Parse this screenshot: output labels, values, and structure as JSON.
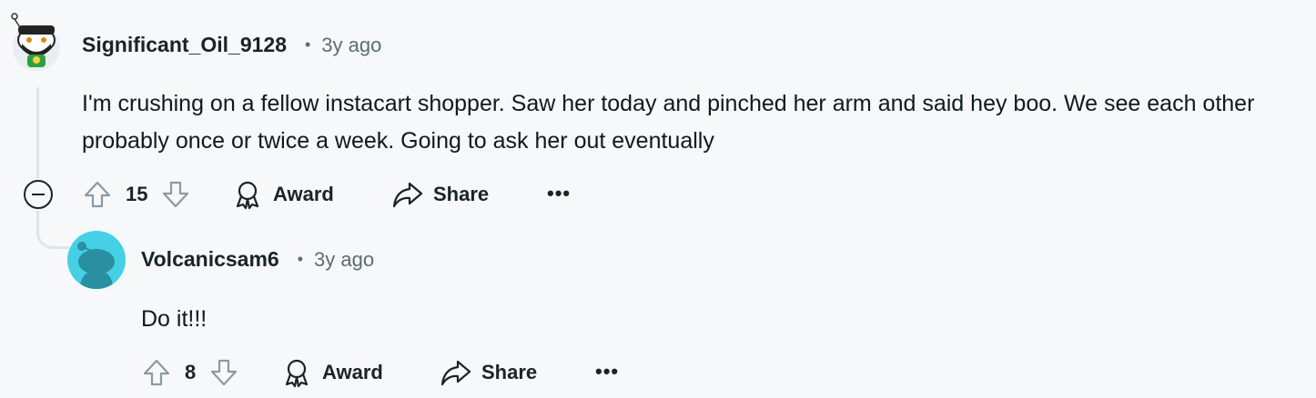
{
  "comments": [
    {
      "username": "Significant_Oil_9128",
      "separator": "•",
      "time": "3y ago",
      "body": "I'm crushing on a fellow instacart shopper. Saw her today and pinched her arm and said hey boo. We see each other probably once or twice a week. Going to ask her out eventually",
      "votes": "15",
      "award_label": "Award",
      "share_label": "Share",
      "more_label": "•••"
    },
    {
      "username": "Volcanicsam6",
      "separator": "•",
      "time": "3y ago",
      "body": "Do it!!!",
      "votes": "8",
      "award_label": "Award",
      "share_label": "Share",
      "more_label": "•••"
    }
  ],
  "colors": {
    "background": "#f6f8f9",
    "thread_line": "#dfe5e8",
    "avatar2_bg": "#45d0e6",
    "text": "#0f1a1c",
    "meta": "#5c6c74"
  },
  "icons": {
    "upvote": "arrow-up-outline",
    "downvote": "arrow-down-outline",
    "award": "award-ribbon",
    "share": "share-arrow",
    "collapse": "minus-circle"
  }
}
